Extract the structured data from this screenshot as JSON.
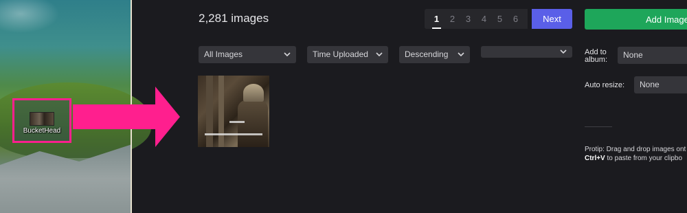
{
  "desktop": {
    "icon_label": "BucketHead",
    "highlight_color": "#ff1f8e"
  },
  "gallery": {
    "count_text": "2,281 images",
    "pagination": {
      "pages": [
        "1",
        "2",
        "3",
        "4",
        "5",
        "6"
      ],
      "active_page": "1",
      "next_label": "Next"
    },
    "add_images_label": "Add Images",
    "filters": {
      "album_filter": "All Images",
      "sort_by": "Time Uploaded",
      "order": "Descending",
      "extra_filter": ""
    },
    "options": {
      "add_to_album_label_line1": "Add to",
      "add_to_album_label_line2": "album:",
      "add_to_album_value": "None",
      "auto_resize_label": "Auto resize:",
      "auto_resize_value": "None"
    },
    "protip": {
      "line1": "Protip: Drag and drop images ont",
      "line2_bold": "Ctrl+V",
      "line2_rest": " to paste from your clipbo"
    }
  },
  "colors": {
    "accent_next": "#5a5fe8",
    "accent_add": "#1ea65a",
    "background": "#1b1b1f"
  }
}
